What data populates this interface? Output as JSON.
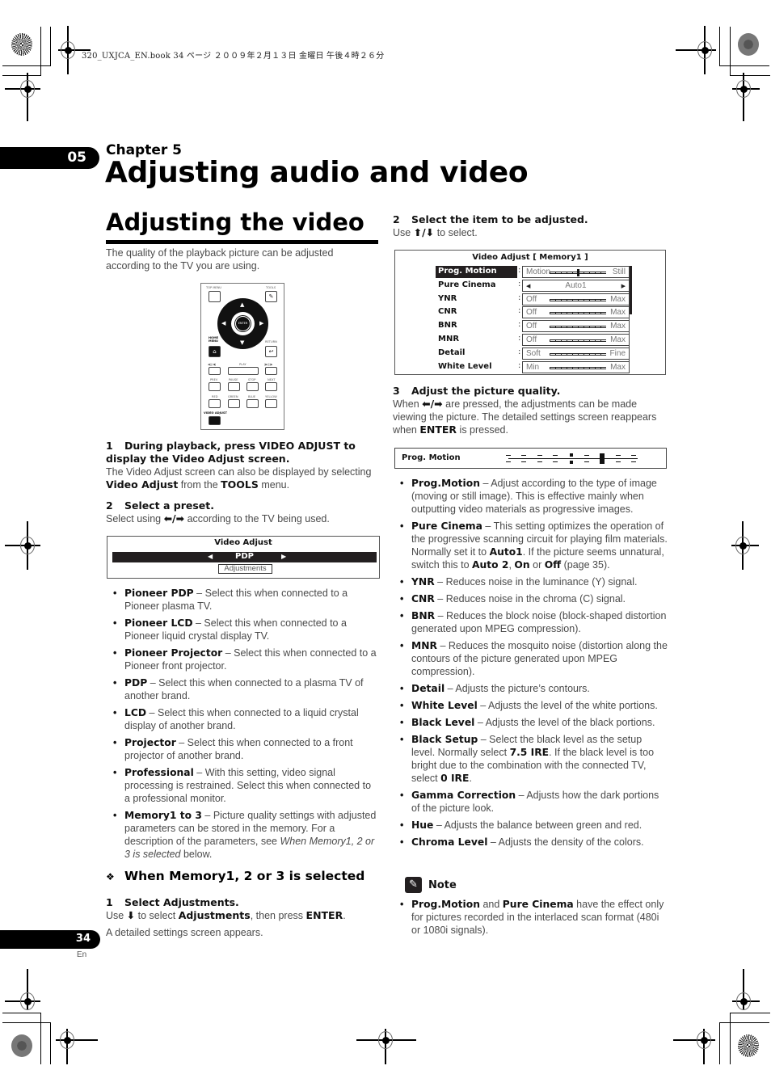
{
  "header_meta": "320_UXJCA_EN.book  34 ページ  ２００９年２月１３日  金曜日  午後４時２６分",
  "chapter": {
    "tab_number": "05",
    "label": "Chapter 5",
    "title": "Adjusting audio and video"
  },
  "section": {
    "title": "Adjusting the video",
    "intro": "The quality of the playback picture can be adjusted according to the TV you are using."
  },
  "remote": {
    "top_menu": "TOP MENU",
    "tools": "TOOLS",
    "enter": "ENTER",
    "home_menu": "HOME MENU",
    "return": "RETURN",
    "rev_step": "◀||/◀|",
    "play": "PLAY",
    "fwd_step": "|▶/||▶",
    "prev": "PREV",
    "pause": "PAUSE",
    "stop": "STOP",
    "next": "NEXT",
    "red": "RED",
    "green": "GREEN",
    "blue": "BLUE",
    "yellow": "YELLOW",
    "video_adjust": "VIDEO ADJUST"
  },
  "left_steps": {
    "step1_num": "1",
    "step1_head": "During playback, press VIDEO ADJUST to display the Video Adjust screen.",
    "step1_body_a": "The Video Adjust screen can also be displayed by selecting ",
    "step1_body_b": "Video Adjust",
    "step1_body_c": " from the ",
    "step1_body_d": "TOOLS",
    "step1_body_e": " menu.",
    "step2_num": "2",
    "step2_head": "Select a preset.",
    "step2_body_a": "Select using ",
    "step2_arrows": "⬅/➡",
    "step2_body_b": " according to the TV being used."
  },
  "video_adjust_screen": {
    "title": "Video Adjust",
    "value": "PDP",
    "left_arrow": "◀",
    "right_arrow": "▶",
    "adjustments": "Adjustments"
  },
  "presets": [
    {
      "term": "Pioneer PDP",
      "desc": " – Select this when connected to a Pioneer plasma TV."
    },
    {
      "term": "Pioneer LCD",
      "desc": " – Select this when connected to a Pioneer liquid crystal display TV."
    },
    {
      "term": "Pioneer Projector",
      "desc": " – Select this when connected to a Pioneer front projector."
    },
    {
      "term": "PDP",
      "desc": " – Select this when connected to a plasma TV of another brand."
    },
    {
      "term": "LCD",
      "desc": " – Select this when connected to a liquid crystal display of another brand."
    },
    {
      "term": "Projector",
      "desc": " – Select this when connected to a front projector of another brand."
    },
    {
      "term": "Professional",
      "desc": " – With this setting, video signal processing is restrained. Select this when connected to a professional monitor."
    },
    {
      "term": "Memory1 to 3",
      "desc": " – Picture quality settings with adjusted parameters can be stored in the memory. For a description of the parameters, see ",
      "italic": "When Memory1, 2 or 3 is selected",
      "after": " below."
    }
  ],
  "memory_section": {
    "icon": "❖",
    "title": "When Memory1, 2 or 3 is selected",
    "step1_num": "1",
    "step1_head": "Select Adjustments.",
    "step1_body_a": "Use ",
    "step1_arrow": "⬇",
    "step1_body_b": " to select ",
    "step1_body_c": "Adjustments",
    "step1_body_d": ", then press ",
    "step1_body_e": "ENTER",
    "step1_body_f": ".",
    "step1_body2": "A detailed settings screen appears."
  },
  "right_steps": {
    "step2_num": "2",
    "step2_head": "Select the item to be adjusted.",
    "step2_body_a": "Use ",
    "step2_arrows": "⬆/⬇",
    "step2_body_b": " to select.",
    "step3_num": "3",
    "step3_head": "Adjust the picture quality.",
    "step3_body_a": "When ",
    "step3_arrows": "⬅/➡",
    "step3_body_b": " are pressed, the adjustments can be made viewing the picture. The detailed settings screen reappears when ",
    "step3_body_c": "ENTER",
    "step3_body_d": " is pressed."
  },
  "memory_screen": {
    "title": "Video Adjust [ Memory1 ]",
    "rows": [
      {
        "name": "Prog. Motion",
        "left": "Motion",
        "right": "Still",
        "type": "slider",
        "level": 0.5,
        "selected": true
      },
      {
        "name": "Pure Cinema",
        "value": "Auto1",
        "type": "select"
      },
      {
        "name": "YNR",
        "left": "Off",
        "right": "Max",
        "type": "slider"
      },
      {
        "name": "CNR",
        "left": "Off",
        "right": "Max",
        "type": "slider"
      },
      {
        "name": "BNR",
        "left": "Off",
        "right": "Max",
        "type": "slider"
      },
      {
        "name": "MNR",
        "left": "Off",
        "right": "Max",
        "type": "slider"
      },
      {
        "name": "Detail",
        "left": "Soft",
        "right": "Fine",
        "type": "slider"
      },
      {
        "name": "White Level",
        "left": "Min",
        "right": "Max",
        "type": "slider"
      }
    ],
    "colon": ":"
  },
  "prog_motion_bar": {
    "label": "Prog. Motion",
    "level": 0.75
  },
  "parameters": [
    {
      "term": "Prog.Motion",
      "desc": " – Adjust according to the type of image (moving or still image). This is effective mainly when outputting video materials as progressive images."
    },
    {
      "term": "Pure Cinema",
      "desc": " – This setting optimizes the operation of the progressive scanning circuit for playing film materials. Normally set it to ",
      "b1": "Auto1",
      "m1": ". If the picture seems unnatural, switch this to ",
      "b2": "Auto 2",
      "m2": ", ",
      "b3": "On",
      "m3": " or ",
      "b4": "Off",
      "m4": " (page 35)."
    },
    {
      "term": "YNR",
      "desc": " – Reduces noise in the luminance (Y) signal."
    },
    {
      "term": "CNR",
      "desc": " – Reduces noise in the chroma (C) signal."
    },
    {
      "term": "BNR",
      "desc": " – Reduces the block noise (block-shaped distortion generated upon MPEG compression)."
    },
    {
      "term": "MNR",
      "desc": " – Reduces the mosquito noise (distortion along the contours of the picture generated upon MPEG compression)."
    },
    {
      "term": "Detail",
      "desc": " – Adjusts the picture’s contours."
    },
    {
      "term": "White Level",
      "desc": " – Adjusts the level of the white portions."
    },
    {
      "term": "Black Level",
      "desc": " – Adjusts the level of the black portions."
    },
    {
      "term": "Black Setup",
      "desc": " – Select the black level as the setup level. Normally select ",
      "b1": "7.5 IRE",
      "m1": ". If the black level is too bright due to the combination with the connected TV, select ",
      "b2": "0 IRE",
      "m2": "."
    },
    {
      "term": "Gamma Correction",
      "desc": " – Adjusts how the dark portions of the picture look."
    },
    {
      "term": "Hue",
      "desc": " – Adjusts the balance between green and red."
    },
    {
      "term": "Chroma Level",
      "desc": " – Adjusts the density of the colors."
    }
  ],
  "note": {
    "title": "Note",
    "icon": "✎",
    "term1": "Prog.Motion",
    "mid": " and ",
    "term2": "Pure Cinema",
    "desc": " have the effect only for pictures recorded in the interlaced scan format (480i or 1080i signals)."
  },
  "footer": {
    "page_number": "34",
    "lang": "En"
  }
}
